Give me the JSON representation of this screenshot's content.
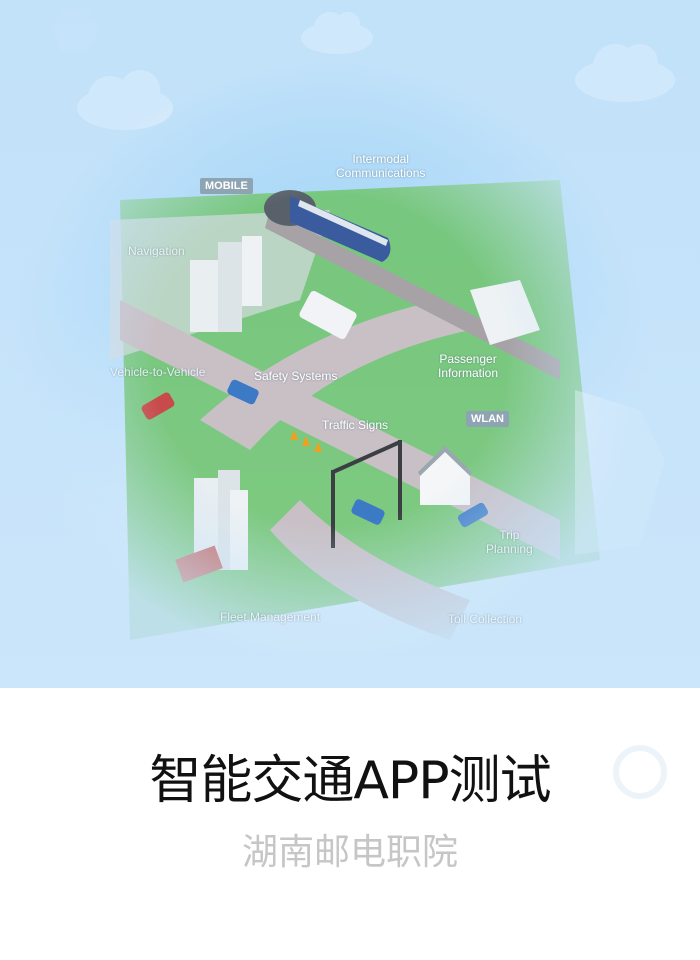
{
  "hero": {
    "labels": {
      "intermodal": "Intermodal\nCommunications",
      "mobile": "MOBILE",
      "navigation": "Navigation",
      "vehicle_to_vehicle": "Vehicle-to-Vehicle",
      "safety_systems": "Safety Systems",
      "traffic_signs": "Traffic Signs",
      "passenger_info": "Passenger\nInformation",
      "wlan": "WLAN",
      "trip_planning": "Trip\nPlanning",
      "fleet_management": "Fleet Management",
      "toll_collection": "Toll Collection"
    },
    "colors": {
      "sky": "#a9d8f7",
      "grass": "#6fc36a",
      "road": "#c9c0c6",
      "building": "#e9eef1"
    }
  },
  "title": "智能交通APP测试",
  "subtitle": "湖南邮电职院"
}
